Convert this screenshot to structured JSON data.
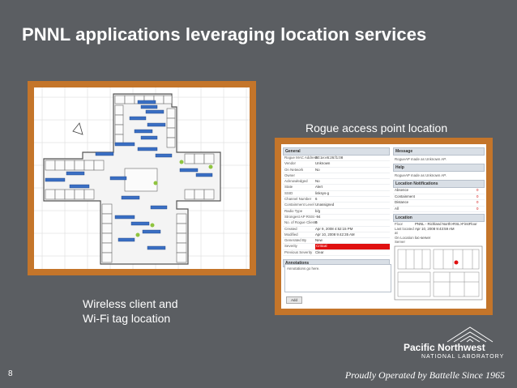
{
  "slide": {
    "title": "PNNL applications leveraging location services",
    "page_number": "8",
    "footer": "Proudly Operated by Battelle Since 1965"
  },
  "captions": {
    "rogue": "Rogue access point location",
    "wireless_line1": "Wireless client and",
    "wireless_line2": "Wi-Fi tag location"
  },
  "logo": {
    "name": "Pacific Northwest",
    "lab": "NATIONAL LABORATORY"
  },
  "rogue_panel": {
    "general_header": "General",
    "rows": [
      {
        "k": "Rogue MAC Address",
        "v": "00:1e:e5:26:f1:08"
      },
      {
        "k": "Vendor",
        "v": "Unknown"
      },
      {
        "k": "On Network",
        "v": "No"
      },
      {
        "k": "Owner",
        "v": ""
      },
      {
        "k": "Acknowledged",
        "v": "No"
      },
      {
        "k": "State",
        "v": "Alert"
      },
      {
        "k": "SSID",
        "v": "linksys-g"
      },
      {
        "k": "Channel Number",
        "v": "6"
      },
      {
        "k": "Containment Level",
        "v": "Unassigned"
      },
      {
        "k": "Radio Type",
        "v": "b/g"
      },
      {
        "k": "Strongest AP RSSI",
        "v": "-94"
      },
      {
        "k": "No. of Rogue Clients",
        "v": "0"
      },
      {
        "k": "Created",
        "v": "Apr 9, 2008 4:52:15 PM"
      },
      {
        "k": "Modified",
        "v": "Apr 10, 2008 9:42:35 AM"
      },
      {
        "k": "Generated By",
        "v": "New"
      },
      {
        "k": "Severity",
        "v": "Critical"
      },
      {
        "k": "Previous Severity",
        "v": "Clear"
      }
    ],
    "annotations_header": "Annotations",
    "annotations_text": "Annotations go here.",
    "add_button": "Add",
    "message_header": "Message",
    "message_text": "RogueAP made as Unknown AP.",
    "help_header": "Help",
    "help_text": "RogueAP made as Unknown AP.",
    "notifications_header": "Location Notifications",
    "notifications": [
      {
        "k": "Absence",
        "v": "0"
      },
      {
        "k": "Containment",
        "v": "0"
      },
      {
        "k": "Distance",
        "v": "0"
      },
      {
        "k": "All",
        "v": "0"
      }
    ],
    "location_header": "Location",
    "location_rows": [
      {
        "k": "Floor",
        "v": "PNNL - Richland North>RSL>FirstFloor"
      },
      {
        "k": "Last located at",
        "v": "Apr 10, 2008 9:43:59 AM"
      },
      {
        "k": "On Location Server",
        "v": "loc-server"
      }
    ]
  },
  "colors": {
    "background": "#5b5e62",
    "frame": "#c4752a",
    "critical": "#e01010"
  }
}
